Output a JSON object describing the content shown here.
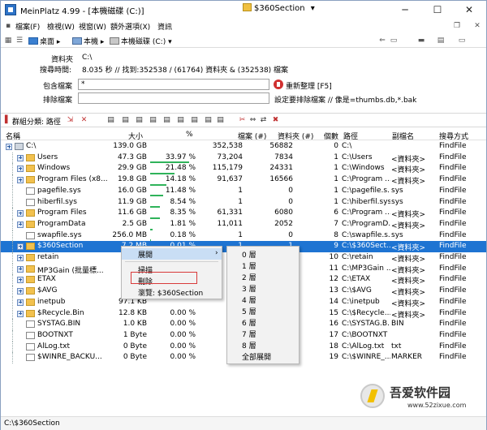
{
  "window": {
    "title": "MeinPlatz 4.99 - [本機磁碟 (C:)]",
    "title_combo": "$360Section",
    "minimize": "─",
    "maximize": "☐",
    "close": "✕"
  },
  "menu": {
    "items": [
      "檔案(F)",
      "檢視(W)",
      "視窗(W)",
      "額外選項(X)",
      "資訊"
    ]
  },
  "address": {
    "crumbs": [
      "桌面",
      "本機",
      "本機磁碟 (C:)"
    ]
  },
  "search": {
    "folder_label": "資料夾",
    "folder_value": "C:\\",
    "time_label": "搜尋時間:",
    "time_value": "8.035 秒 // 找到:352538 / (61764) 資料夾 & (352538) 檔案",
    "include_label": "包含檔案",
    "include_value": "*",
    "refresh_label": "重新整理 [F5]",
    "exclude_label": "排除檔案",
    "exclude_value": "",
    "exclude_hint": "設定要排除檔案 // 像是=thumbs.db,*.bak"
  },
  "toolbar": {
    "group_label": "群組分類: 路徑"
  },
  "columns": [
    "名稱",
    "大小",
    "%",
    "檔案 (#)",
    "資料夾 (#)",
    "個數",
    "路徑",
    "副檔名",
    "搜尋方式"
  ],
  "rows": [
    {
      "name": "C:\\",
      "size": "139.0 GB",
      "pct": "",
      "pct_value": 0,
      "files": "352,538",
      "folders": "56882",
      "count": "0",
      "path": "C:\\",
      "ext": "",
      "method": "FindFile",
      "icon": "drive",
      "indent": 0,
      "expand": true
    },
    {
      "name": "Users",
      "size": "47.3 GB",
      "pct": "33.97 %",
      "pct_value": 33.97,
      "files": "73,204",
      "folders": "7834",
      "count": "1",
      "path": "C:\\Users",
      "ext": "<資料夾>",
      "method": "FindFile",
      "icon": "folder",
      "indent": 1,
      "expand": true
    },
    {
      "name": "Windows",
      "size": "29.9 GB",
      "pct": "21.48 %",
      "pct_value": 21.48,
      "files": "115,179",
      "folders": "24331",
      "count": "1",
      "path": "C:\\Windows",
      "ext": "<資料夾>",
      "method": "FindFile",
      "icon": "folder",
      "indent": 1,
      "expand": true
    },
    {
      "name": "Program Files (x8...",
      "size": "19.8 GB",
      "pct": "14.18 %",
      "pct_value": 14.18,
      "files": "91,637",
      "folders": "16566",
      "count": "1",
      "path": "C:\\Program ...",
      "ext": "<資料夾>",
      "method": "FindFile",
      "icon": "folder",
      "indent": 1,
      "expand": true
    },
    {
      "name": "pagefile.sys",
      "size": "16.0 GB",
      "pct": "11.48 %",
      "pct_value": 11.48,
      "files": "1",
      "folders": "0",
      "count": "1",
      "path": "C:\\pagefile.s...",
      "ext": "sys",
      "method": "FindFile",
      "icon": "file",
      "indent": 1,
      "expand": false
    },
    {
      "name": "hiberfil.sys",
      "size": "11.9 GB",
      "pct": "8.54 %",
      "pct_value": 8.54,
      "files": "1",
      "folders": "0",
      "count": "1",
      "path": "C:\\hiberfil.sys",
      "ext": "sys",
      "method": "FindFile",
      "icon": "file",
      "indent": 1,
      "expand": false
    },
    {
      "name": "Program Files",
      "size": "11.6 GB",
      "pct": "8.35 %",
      "pct_value": 8.35,
      "files": "61,331",
      "folders": "6080",
      "count": "6",
      "path": "C:\\Program ...",
      "ext": "<資料夾>",
      "method": "FindFile",
      "icon": "folder",
      "indent": 1,
      "expand": true
    },
    {
      "name": "ProgramData",
      "size": "2.5 GB",
      "pct": "1.81 %",
      "pct_value": 1.81,
      "files": "11,011",
      "folders": "2052",
      "count": "7",
      "path": "C:\\ProgramD...",
      "ext": "<資料夾>",
      "method": "FindFile",
      "icon": "folder",
      "indent": 1,
      "expand": true
    },
    {
      "name": "swapfile.sys",
      "size": "256.0 MB",
      "pct": "0.18 %",
      "pct_value": 0.18,
      "files": "1",
      "folders": "0",
      "count": "8",
      "path": "C:\\swapfile.s...",
      "ext": "sys",
      "method": "FindFile",
      "icon": "file",
      "indent": 1,
      "expand": false
    },
    {
      "name": "$360Section",
      "size": "7.2 MB",
      "pct": "0.01 %",
      "pct_value": 0.01,
      "files": "1",
      "folders": "1",
      "count": "9",
      "path": "C:\\$360Sect...",
      "ext": "<資料夾>",
      "method": "FindFile",
      "icon": "folder",
      "indent": 1,
      "expand": true,
      "selected": true
    },
    {
      "name": "retain",
      "size": "",
      "pct": "",
      "pct_value": 0,
      "files": "",
      "folders": "",
      "count": "10",
      "path": "C:\\retain",
      "ext": "<資料夾>",
      "method": "FindFile",
      "icon": "folder",
      "indent": 1,
      "expand": true
    },
    {
      "name": "MP3Gain (批量標...",
      "size": "",
      "pct": "",
      "pct_value": 0,
      "files": "",
      "folders": "",
      "count": "11",
      "path": "C:\\MP3Gain ...",
      "ext": "<資料夾>",
      "method": "FindFile",
      "icon": "folder",
      "indent": 1,
      "expand": true
    },
    {
      "name": "ETAX",
      "size": "",
      "pct": "",
      "pct_value": 0,
      "files": "",
      "folders": "",
      "count": "12",
      "path": "C:\\ETAX",
      "ext": "<資料夾>",
      "method": "FindFile",
      "icon": "folder",
      "indent": 1,
      "expand": true
    },
    {
      "name": "$AVG",
      "size": "",
      "pct": "",
      "pct_value": 0,
      "files": "",
      "folders": "",
      "count": "13",
      "path": "C:\\$AVG",
      "ext": "<資料夾>",
      "method": "FindFile",
      "icon": "folder",
      "indent": 1,
      "expand": true
    },
    {
      "name": "inetpub",
      "size": "97.1 KB",
      "pct": "",
      "pct_value": 0,
      "files": "",
      "folders": "",
      "count": "14",
      "path": "C:\\inetpub",
      "ext": "<資料夾>",
      "method": "FindFile",
      "icon": "folder",
      "indent": 1,
      "expand": true
    },
    {
      "name": "$Recycle.Bin",
      "size": "12.8 KB",
      "pct": "0.00 %",
      "pct_value": 0,
      "files": "",
      "folders": "",
      "count": "15",
      "path": "C:\\$Recycle...",
      "ext": "<資料夾>",
      "method": "FindFile",
      "icon": "folder",
      "indent": 1,
      "expand": true
    },
    {
      "name": "SYSTAG.BIN",
      "size": "1.0 KB",
      "pct": "0.00 %",
      "pct_value": 0,
      "files": "",
      "folders": "",
      "count": "16",
      "path": "C:\\SYSTAG.B...",
      "ext": "BIN",
      "method": "FindFile",
      "icon": "file",
      "indent": 1,
      "expand": false
    },
    {
      "name": "BOOTNXT",
      "size": "1 Byte",
      "pct": "0.00 %",
      "pct_value": 0,
      "files": "",
      "folders": "",
      "count": "17",
      "path": "C:\\BOOTNXT",
      "ext": "",
      "method": "FindFile",
      "icon": "file",
      "indent": 1,
      "expand": false
    },
    {
      "name": "AlLog.txt",
      "size": "0 Byte",
      "pct": "0.00 %",
      "pct_value": 0,
      "files": "",
      "folders": "",
      "count": "18",
      "path": "C:\\AlLog.txt",
      "ext": "txt",
      "method": "FindFile",
      "icon": "file",
      "indent": 1,
      "expand": false
    },
    {
      "name": "$WINRE_BACKU...",
      "size": "0 Byte",
      "pct": "0.00 %",
      "pct_value": 0,
      "files": "",
      "folders": "",
      "count": "19",
      "path": "C:\\$WINRE_...",
      "ext": "MARKER",
      "method": "FindFile",
      "icon": "file",
      "indent": 1,
      "expand": false
    }
  ],
  "context_menu": {
    "items": [
      "展開",
      "掃描",
      "刪除",
      "瀏覽: $360Section"
    ],
    "highlighted": "刪除"
  },
  "submenu": {
    "items": [
      "0 層",
      "1 層",
      "2 層",
      "3 層",
      "4 層",
      "5 層",
      "6 層",
      "7 層",
      "8 層",
      "全部展開"
    ]
  },
  "status": {
    "text": "C:\\$360Section"
  },
  "watermark": {
    "brand": "吾爱软件园",
    "url": "www.52zixue.com"
  },
  "colors": {
    "selection": "#1e74d2",
    "pct_bar": "#2fb35a",
    "highlight_box": "#d83a3a"
  }
}
